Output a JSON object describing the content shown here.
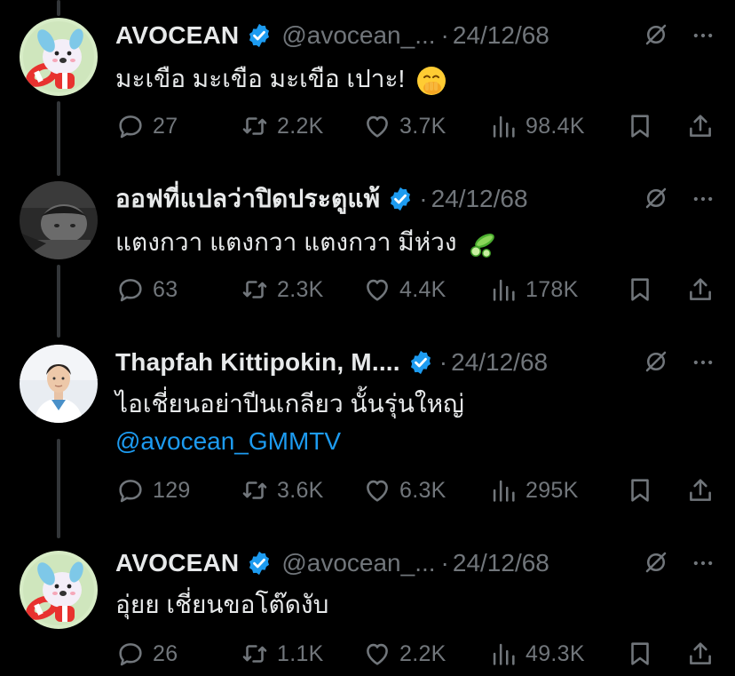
{
  "colors": {
    "background": "#000000",
    "primary_text": "#e7e9ea",
    "secondary_text": "#71767b",
    "accent": "#1d9bf0",
    "thread_line": "#333639"
  },
  "tweets": [
    {
      "name": "AVOCEAN",
      "verified": true,
      "handle": "@avocean_...",
      "separator": "·",
      "date": "24/12/68",
      "text": "มะเขือ มะเขือ มะเขือ เปาะ!",
      "emoji": "face-with-hand-over-mouth",
      "replies": "27",
      "retweets": "2.2K",
      "likes": "3.7K",
      "views": "98.4K"
    },
    {
      "name": "ออฟที่แปลว่าปิดประตูแพ้",
      "verified": true,
      "handle": "",
      "separator": "·",
      "date": "24/12/68",
      "text": "แตงกวา แตงกวา แตงกวา มีห่วง",
      "emoji": "cucumber",
      "replies": "63",
      "retweets": "2.3K",
      "likes": "4.4K",
      "views": "178K"
    },
    {
      "name": "Thapfah Kittipokin, M....",
      "verified": true,
      "handle": "",
      "separator": "·",
      "date": "24/12/68",
      "text": "ไอเชี่ยนอย่าปีนเกลียว นั้นรุ่นใหญ่",
      "mention": "@avocean_GMMTV",
      "replies": "129",
      "retweets": "3.6K",
      "likes": "6.3K",
      "views": "295K"
    },
    {
      "name": "AVOCEAN",
      "verified": true,
      "handle": "@avocean_...",
      "separator": "·",
      "date": "24/12/68",
      "text": "อุ่ยย เชี่ยนขอโต๊ดงับ",
      "replies": "26",
      "retweets": "1.1K",
      "likes": "2.2K",
      "views": "49.3K"
    }
  ]
}
